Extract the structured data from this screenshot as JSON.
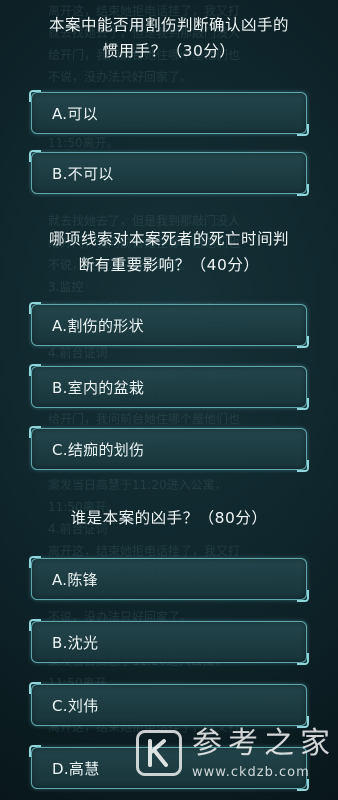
{
  "questions": [
    {
      "text": "本案中能否用割伤判断确认凶手的惯用手？（30分）",
      "options": [
        "A.可以",
        "B.不可以"
      ]
    },
    {
      "text": "哪项线索对本案死者的死亡时间判断有重要影响？（40分）",
      "options": [
        "A.割伤的形状",
        "B.室内的盆栽",
        "C.结痂的划伤"
      ]
    },
    {
      "text": "谁是本案的凶手？（80分）",
      "options": [
        "A.陈锋",
        "B.沈光",
        "C.刘伟",
        "D.高慧"
      ]
    }
  ],
  "question_lines": {
    "q1": [
      "本案中能否用割伤判断确认凶手的",
      "惯用手？（30分）"
    ],
    "q2": [
      "哪项线索对本案死者的死亡时间判",
      "断有重要影响？（40分）"
    ],
    "q3": [
      "谁是本案的凶手？（80分）"
    ]
  },
  "background_text": [
    "离开这，结束她拒电话挂了，我又打",
    "给开门，我问前台她住哪个屋他们也",
    "不说，没办法只好回家了。",
    "3.监控",
    "案发当日高慧于11:20进入公寓，",
    "11:50离开。",
    "4.前台证词",
    "就去找她去了，但是我到那敲门没人"
  ],
  "watermark": {
    "name": "参考之家",
    "url": "www.ckdzb.com",
    "logo_letter": "K"
  }
}
